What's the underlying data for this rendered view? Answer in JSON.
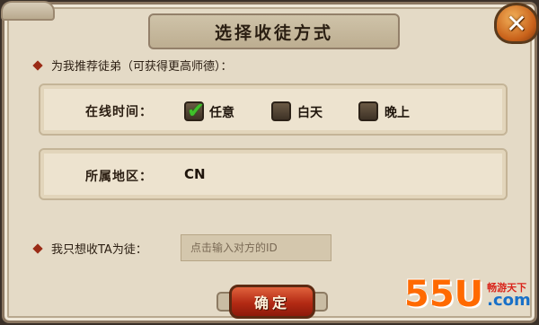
{
  "dialog": {
    "title": "选择收徒方式",
    "close_label": "✕"
  },
  "recommend": {
    "label": "为我推荐徒弟（可获得更高师德）："
  },
  "online": {
    "label": "在线时间：",
    "options": [
      {
        "label": "任意",
        "checked": true
      },
      {
        "label": "白天",
        "checked": false
      },
      {
        "label": "晚上",
        "checked": false
      }
    ]
  },
  "region": {
    "label": "所属地区：",
    "value": "CN"
  },
  "specific": {
    "label": "我只想收TA为徒：",
    "placeholder": "点击输入对方的ID"
  },
  "confirm": {
    "label": "确定"
  },
  "watermark": {
    "main": "55U",
    "slogan": "畅游天下",
    "domain": ".com"
  },
  "colors": {
    "accent_check": "#3fc12a",
    "confirm_button": "#b32a14",
    "close_button": "#c8611a",
    "bullet": "#9a2b16"
  }
}
